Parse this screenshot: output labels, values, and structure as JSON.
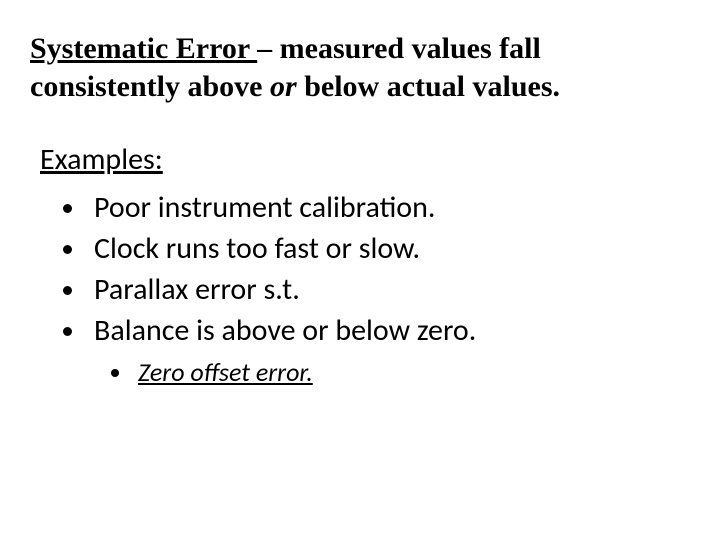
{
  "title": {
    "term": "Systematic Error ",
    "rest_before_or": "– measured values fall consistently above ",
    "or_word": "or",
    "rest_after_or": " below actual values."
  },
  "examples_label": "Examples:",
  "bullets": [
    "Poor instrument calibration.",
    "Clock runs too fast or slow.",
    "Parallax error s.t.",
    "Balance is above or below zero."
  ],
  "sub_bullet": "Zero offset error."
}
